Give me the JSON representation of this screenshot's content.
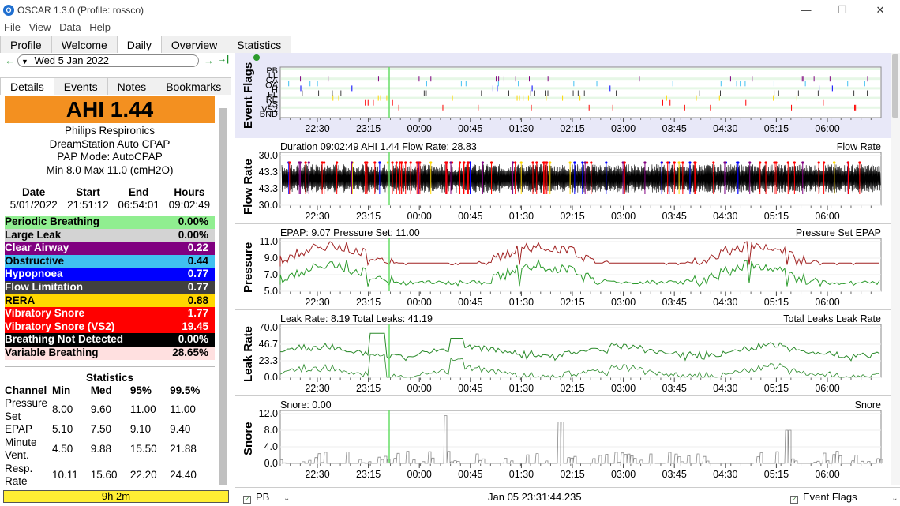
{
  "window": {
    "title": "OSCAR 1.3.0 (Profile: rossco)",
    "min": "—",
    "restore": "❐",
    "close": "✕"
  },
  "menu": [
    "File",
    "View",
    "Data",
    "Help"
  ],
  "tabs": [
    "Profile",
    "Welcome",
    "Daily",
    "Overview",
    "Statistics"
  ],
  "active_tab": "Daily",
  "datenav": {
    "prev": "←",
    "date": "Wed 5 Jan 2022",
    "next": "→",
    "last": "→|"
  },
  "subtabs": [
    "Details",
    "Events",
    "Notes",
    "Bookmarks"
  ],
  "ahi_label": "AHI  1.44",
  "device": [
    "Philips Respironics",
    "DreamStation Auto CPAP",
    "PAP Mode: AutoCPAP",
    "Min 8.0 Max 11.0 (cmH2O)"
  ],
  "summary": {
    "headers": [
      "Date",
      "Start",
      "End",
      "Hours"
    ],
    "row": [
      "5/01/2022",
      "21:51:12",
      "06:54:01",
      "09:02:49"
    ]
  },
  "events": [
    {
      "name": "Periodic Breathing",
      "value": "0.00%",
      "bg": "#90ee90",
      "fg": "#000000"
    },
    {
      "name": "Large Leak",
      "value": "0.00%",
      "bg": "#d3d3d3",
      "fg": "#000000"
    },
    {
      "name": "Clear Airway",
      "value": "0.22",
      "bg": "#800080",
      "fg": "#ffffff"
    },
    {
      "name": "Obstructive",
      "value": "0.44",
      "bg": "#40c0f0",
      "fg": "#000000"
    },
    {
      "name": "Hypopnoea",
      "value": "0.77",
      "bg": "#0000ff",
      "fg": "#ffffff"
    },
    {
      "name": "Flow Limitation",
      "value": "0.77",
      "bg": "#404040",
      "fg": "#ffffff"
    },
    {
      "name": "RERA",
      "value": "0.88",
      "bg": "#ffd700",
      "fg": "#000000"
    },
    {
      "name": "Vibratory Snore",
      "value": "1.77",
      "bg": "#ff0000",
      "fg": "#ffffff"
    },
    {
      "name": "Vibratory Snore (VS2)",
      "value": "19.45",
      "bg": "#ff0000",
      "fg": "#ffffff"
    },
    {
      "name": "Breathing Not Detected",
      "value": "0.00%",
      "bg": "#000000",
      "fg": "#ffffff"
    },
    {
      "name": "Variable Breathing",
      "value": "28.65%",
      "bg": "#ffe0e0",
      "fg": "#000000"
    }
  ],
  "statistics": {
    "title": "Statistics",
    "headers": [
      "Channel",
      "Min",
      "Med",
      "95%",
      "99.5%"
    ],
    "rows": [
      [
        "Pressure Set",
        "8.00",
        "9.60",
        "11.00",
        "11.00"
      ],
      [
        "EPAP",
        "5.10",
        "7.50",
        "9.10",
        "9.40"
      ],
      [
        "Minute Vent.",
        "4.50",
        "9.88",
        "15.50",
        "21.88"
      ],
      [
        "Resp. Rate",
        "10.11",
        "15.60",
        "22.20",
        "24.40"
      ]
    ]
  },
  "duration": "9h 2m",
  "time_ticks": [
    "22:30",
    "23:15",
    "00:00",
    "00:45",
    "01:30",
    "02:15",
    "03:00",
    "03:45",
    "04:30",
    "05:15",
    "06:00"
  ],
  "graphs": {
    "event_flags": {
      "label": "Event Flags",
      "rows": [
        "PB",
        "LL",
        "CA",
        "OA",
        "H",
        "FL",
        "RE",
        "VS",
        "VS2",
        "BND"
      ]
    },
    "flow": {
      "label": "Flow Rate",
      "header": "Duration 09:02:49 AHI 1.44 Flow Rate: 28.83",
      "legend": "Flow Rate",
      "yticks": [
        "30.0",
        "43.3",
        "43.3",
        "30.0"
      ]
    },
    "pressure": {
      "label": "Pressure",
      "header": "EPAP: 9.07 Pressure Set: 11.00",
      "legend": "Pressure Set EPAP",
      "yticks": [
        "11.0",
        "9.0",
        "7.0",
        "5.0"
      ]
    },
    "leak": {
      "label": "Leak Rate",
      "header": "Leak Rate: 8.19 Total Leaks: 41.19",
      "legend": "Total Leaks Leak Rate",
      "yticks": [
        "70.0",
        "46.7",
        "23.3",
        "0.0"
      ]
    },
    "snore": {
      "label": "Snore",
      "header": "Snore: 0.00",
      "legend": "Snore",
      "yticks": [
        "12.0",
        "8.0",
        "4.0",
        "0.0"
      ]
    }
  },
  "colors": {
    "accent": "#f39020",
    "pressure": "#a02020",
    "epap": "#2a9a2a",
    "cursor": "#66dd66"
  },
  "status": {
    "left": "PB",
    "mid": "Jan 05 23:31:44.235",
    "right": "Event Flags"
  }
}
